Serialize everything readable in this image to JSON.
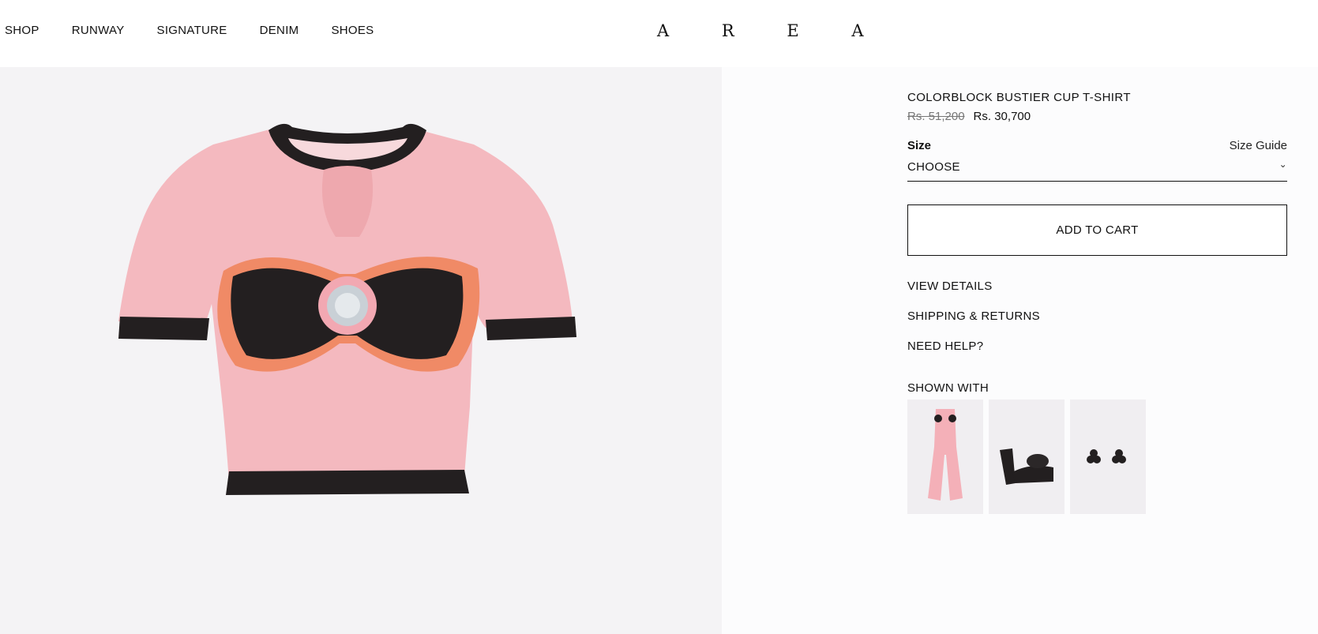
{
  "nav": {
    "items": [
      "SHOP",
      "RUNWAY",
      "SIGNATURE",
      "DENIM",
      "SHOES"
    ],
    "logo": "A R E A"
  },
  "gallery": {
    "image_icon": "pink-colorblock-tshirt-image"
  },
  "product": {
    "title": "COLORBLOCK BUSTIER CUP T-SHIRT",
    "old_price": "Rs. 51,200",
    "new_price": "Rs. 30,700",
    "size_label": "Size",
    "size_guide": "Size Guide",
    "size_select_value": "CHOOSE",
    "add_to_cart": "ADD TO CART",
    "links": [
      "VIEW DETAILS",
      "SHIPPING & RETURNS",
      "NEED HELP?"
    ],
    "shown_with_label": "SHOWN WITH",
    "shown_with_icons": [
      "pink-flared-pants-image",
      "black-platform-sandal-image",
      "black-flower-earrings-image"
    ]
  },
  "colors": {
    "pink": "#f4b9bf",
    "black": "#231f20",
    "orange": "#f08a66"
  }
}
